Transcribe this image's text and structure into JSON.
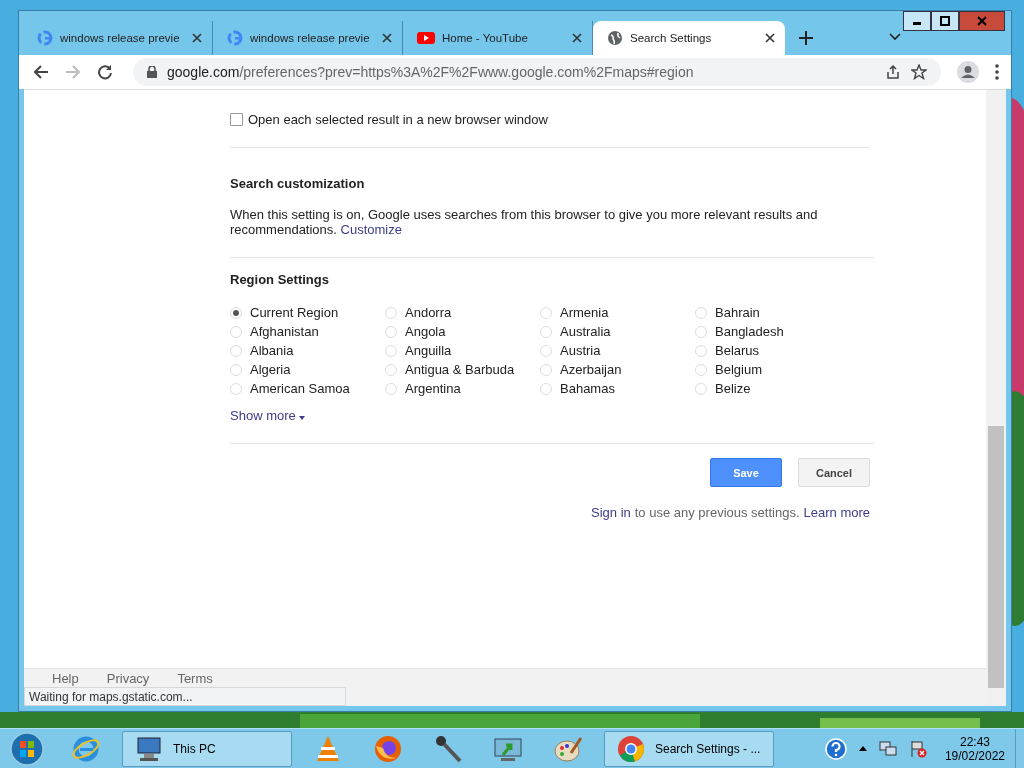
{
  "tabs": [
    {
      "title": "windows release previe",
      "kind": "google",
      "selected": false
    },
    {
      "title": "windows release previe",
      "kind": "google",
      "selected": false
    },
    {
      "title": "Home - YouTube",
      "kind": "youtube",
      "selected": false
    },
    {
      "title": "Search Settings",
      "kind": "globe",
      "selected": true
    }
  ],
  "address": {
    "domain": "google.com",
    "path": "/preferences?prev=https%3A%2F%2Fwww.google.com%2Fmaps#region"
  },
  "results_option": {
    "label": "Open each selected result in a new browser window",
    "checked": false
  },
  "customization": {
    "heading": "Search customization",
    "text": "When this setting is on, Google uses searches from this browser to give you more relevant results and recommendations.",
    "link": "Customize"
  },
  "region": {
    "heading": "Region Settings",
    "columns": [
      [
        {
          "label": "Current Region",
          "selected": true
        },
        {
          "label": "Afghanistan",
          "selected": false
        },
        {
          "label": "Albania",
          "selected": false
        },
        {
          "label": "Algeria",
          "selected": false
        },
        {
          "label": "American Samoa",
          "selected": false
        }
      ],
      [
        {
          "label": "Andorra",
          "selected": false
        },
        {
          "label": "Angola",
          "selected": false
        },
        {
          "label": "Anguilla",
          "selected": false
        },
        {
          "label": "Antigua & Barbuda",
          "selected": false
        },
        {
          "label": "Argentina",
          "selected": false
        }
      ],
      [
        {
          "label": "Armenia",
          "selected": false
        },
        {
          "label": "Australia",
          "selected": false
        },
        {
          "label": "Austria",
          "selected": false
        },
        {
          "label": "Azerbaijan",
          "selected": false
        },
        {
          "label": "Bahamas",
          "selected": false
        }
      ],
      [
        {
          "label": "Bahrain",
          "selected": false
        },
        {
          "label": "Bangladesh",
          "selected": false
        },
        {
          "label": "Belarus",
          "selected": false
        },
        {
          "label": "Belgium",
          "selected": false
        },
        {
          "label": "Belize",
          "selected": false
        }
      ]
    ],
    "show_more": "Show more"
  },
  "buttons": {
    "save": "Save",
    "cancel": "Cancel"
  },
  "signin": {
    "link": "Sign in",
    "text": "to use any previous settings.",
    "learn_more": "Learn more"
  },
  "footer_links": [
    "Help",
    "Privacy",
    "Terms"
  ],
  "status": "Waiting for maps.gstatic.com...",
  "taskbar": {
    "items": [
      {
        "kind": "ie"
      },
      {
        "kind": "computer",
        "label": "This PC"
      },
      {
        "kind": "vlc"
      },
      {
        "kind": "firefox"
      },
      {
        "kind": "microphone"
      },
      {
        "kind": "monitor"
      },
      {
        "kind": "palette"
      },
      {
        "kind": "chrome",
        "label": "Search Settings - ..."
      }
    ],
    "time": "22:43",
    "date": "19/02/2022"
  }
}
